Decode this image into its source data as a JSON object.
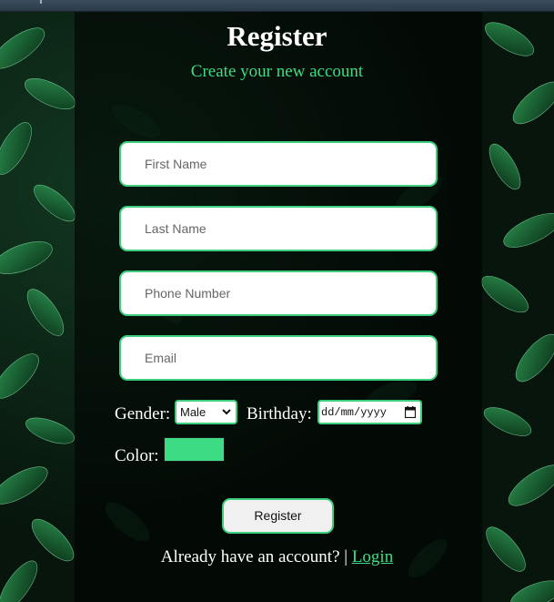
{
  "header": {
    "title": "Register",
    "subtitle": "Create your new account"
  },
  "form": {
    "first_name_placeholder": "First Name",
    "last_name_placeholder": "Last Name",
    "phone_placeholder": "Phone Number",
    "email_placeholder": "Email",
    "gender_label": "Gender:",
    "gender_value": "Male",
    "birthday_label": "Birthday:",
    "birthday_value": "dd/mm/yyyy",
    "color_label": "Color:",
    "color_value": "#3ddc84",
    "submit_label": "Register"
  },
  "footer": {
    "prompt": "Already have an account? |",
    "login_link": "Login"
  },
  "colors": {
    "accent": "#3ddc84",
    "border": "#3ecf7e"
  },
  "icons": {
    "gender_dropdown": "chevron-down-icon",
    "birthday_picker": "calendar-icon"
  }
}
